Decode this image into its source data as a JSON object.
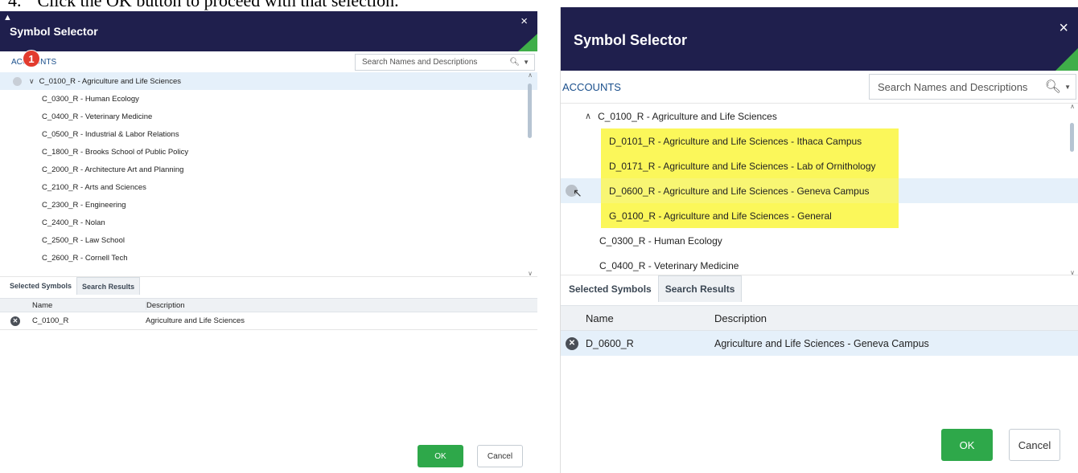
{
  "caption": {
    "number": "4.",
    "text": "Click the OK button to proceed with that selection."
  },
  "left": {
    "title": "Symbol Selector",
    "close": "×",
    "tree_label": "ACCOUNTS",
    "badge": "1",
    "search": {
      "placeholder": "Search Names and Descriptions"
    },
    "tree": {
      "parent": "C_0100_R - Agriculture and Life Sciences",
      "items": [
        "C_0300_R - Human Ecology",
        "C_0400_R - Veterinary Medicine",
        "C_0500_R - Industrial & Labor Relations",
        "C_1800_R - Brooks School of Public Policy",
        "C_2000_R - Architecture Art and Planning",
        "C_2100_R - Arts and Sciences",
        "C_2300_R - Engineering",
        "C_2400_R - Nolan",
        "C_2500_R - Law School",
        "C_2600_R - Cornell Tech"
      ]
    },
    "tabs": [
      "Selected Symbols",
      "Search Results"
    ],
    "grid": {
      "headers": {
        "name": "Name",
        "description": "Description"
      },
      "rows": [
        {
          "name": "C_0100_R",
          "description": "Agriculture and Life Sciences"
        }
      ]
    },
    "ok": "OK",
    "cancel": "Cancel"
  },
  "right": {
    "title": "Symbol Selector",
    "close": "×",
    "tree_label": "ACCOUNTS",
    "search": {
      "placeholder": "Search Names and Descriptions"
    },
    "tree": {
      "parent": "C_0100_R - Agriculture and Life Sciences",
      "children": [
        "D_0101_R - Agriculture and Life Sciences - Ithaca Campus",
        "D_0171_R - Agriculture and Life Sciences - Lab of Ornithology",
        "D_0600_R - Agriculture and Life Sciences - Geneva Campus",
        "G_0100_R - Agriculture and Life Sciences - General"
      ],
      "items": [
        "C_0300_R - Human Ecology",
        "C_0400_R - Veterinary Medicine"
      ]
    },
    "highlight_color": "#fbf75a",
    "tabs": [
      "Selected Symbols",
      "Search Results"
    ],
    "grid": {
      "headers": {
        "name": "Name",
        "description": "Description"
      },
      "rows": [
        {
          "name": "D_0600_R",
          "description": "Agriculture and Life Sciences - Geneva Campus"
        }
      ]
    },
    "ok": "OK",
    "cancel": "Cancel"
  },
  "colors": {
    "titlebar": "#1f1f4d",
    "accent_green": "#2ea84a",
    "link_blue": "#1a4f8c",
    "badge_red": "#e23b2e"
  }
}
